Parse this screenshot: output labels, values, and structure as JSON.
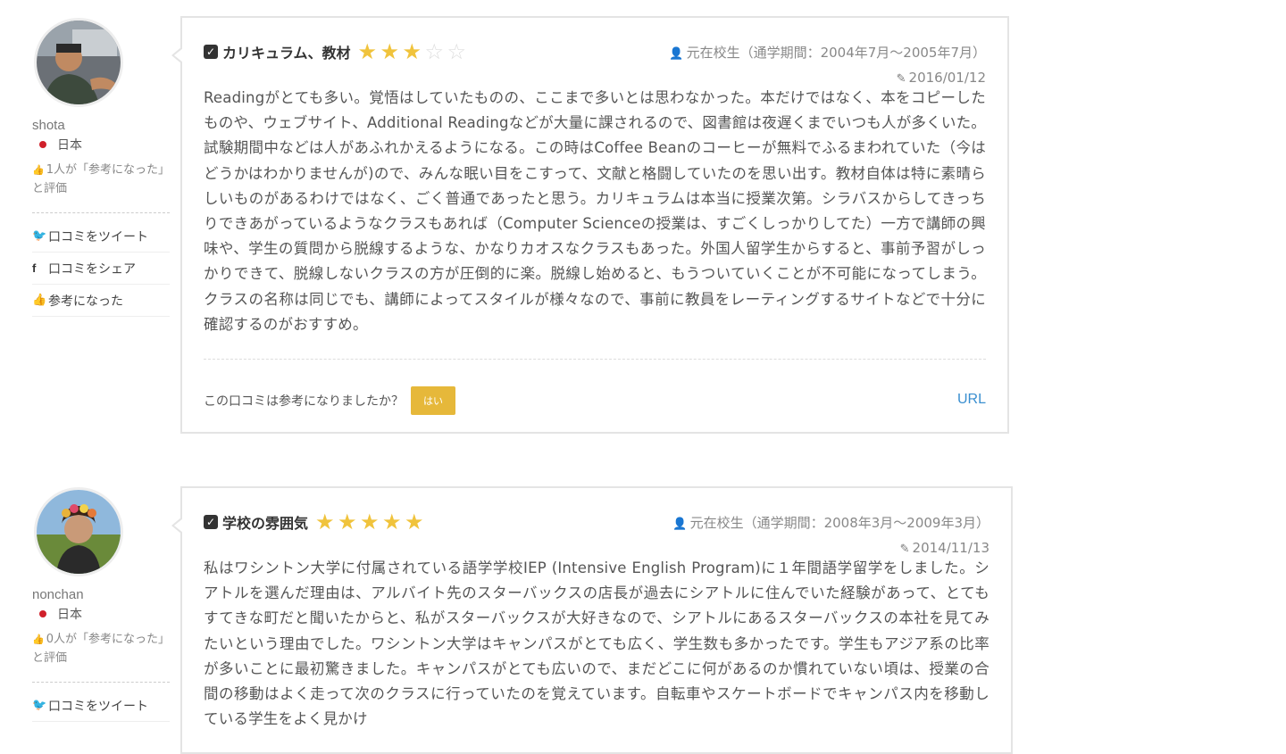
{
  "reviews": [
    {
      "user": {
        "name": "shota",
        "country": "日本",
        "helpful_text": "1人が「参考になった」と評価"
      },
      "actions": {
        "tweet": "口コミをツイート",
        "share": "口コミをシェア",
        "helpful": "参考になった"
      },
      "category": "カリキュラム、教材",
      "rating": 3,
      "max_rating": 5,
      "status": "元在校生（通学期間：2004年7月〜2005年7月）",
      "date": "2016/01/12",
      "body": "Readingがとても多い。覚悟はしていたものの、ここまで多いとは思わなかった。本だけではなく、本をコピーしたものや、ウェブサイト、Additional Readingなどが大量に課されるので、図書館は夜遅くまでいつも人が多くいた。試験期間中などは人があふれかえるようになる。この時はCoffee Beanのコーヒーが無料でふるまわれていた（今はどうかはわかりませんが)ので、みんな眠い目をこすって、文献と格闘していたのを思い出す。教材自体は特に素晴らしいものがあるわけではなく、ごく普通であったと思う。カリキュラムは本当に授業次第。シラバスからしてきっちりできあがっているようなクラスもあれば（Computer Scienceの授業は、すごくしっかりしてた）一方で講師の興味や、学生の質問から脱線するような、かなりカオスなクラスもあった。外国人留学生からすると、事前予習がしっかりできて、脱線しないクラスの方が圧倒的に楽。脱線し始めると、もうついていくことが不可能になってしまう。クラスの名称は同じでも、講師によってスタイルが様々なので、事前に教員をレーティングするサイトなどで十分に確認するのがおすすめ。",
      "helpful_question": "この口コミは参考になりましたか？",
      "yes_label": "はい",
      "url_label": "URL"
    },
    {
      "user": {
        "name": "nonchan",
        "country": "日本",
        "helpful_text": "0人が「参考になった」と評価"
      },
      "actions": {
        "tweet": "口コミをツイート"
      },
      "category": "学校の雰囲気",
      "rating": 5,
      "max_rating": 5,
      "status": "元在校生（通学期間：2008年3月〜2009年3月）",
      "date": "2014/11/13",
      "body": "私はワシントン大学に付属されている語学学校IEP (Intensive English Program)に１年間語学留学をしました。シアトルを選んだ理由は、アルバイト先のスターバックスの店長が過去にシアトルに住んでいた経験があって、とてもすてきな町だと聞いたからと、私がスターバックスが大好きなので、シアトルにあるスターバックスの本社を見てみたいという理由でした。ワシントン大学はキャンパスがとても広く、学生数も多かったです。学生もアジア系の比率が多いことに最初驚きました。キャンパスがとても広いので、まだどこに何があるのか慣れていない頃は、授業の合間の移動はよく走って次のクラスに行っていたのを覚えています。自転車やスケートボードでキャンパス内を移動している学生をよく見かけ"
    }
  ]
}
